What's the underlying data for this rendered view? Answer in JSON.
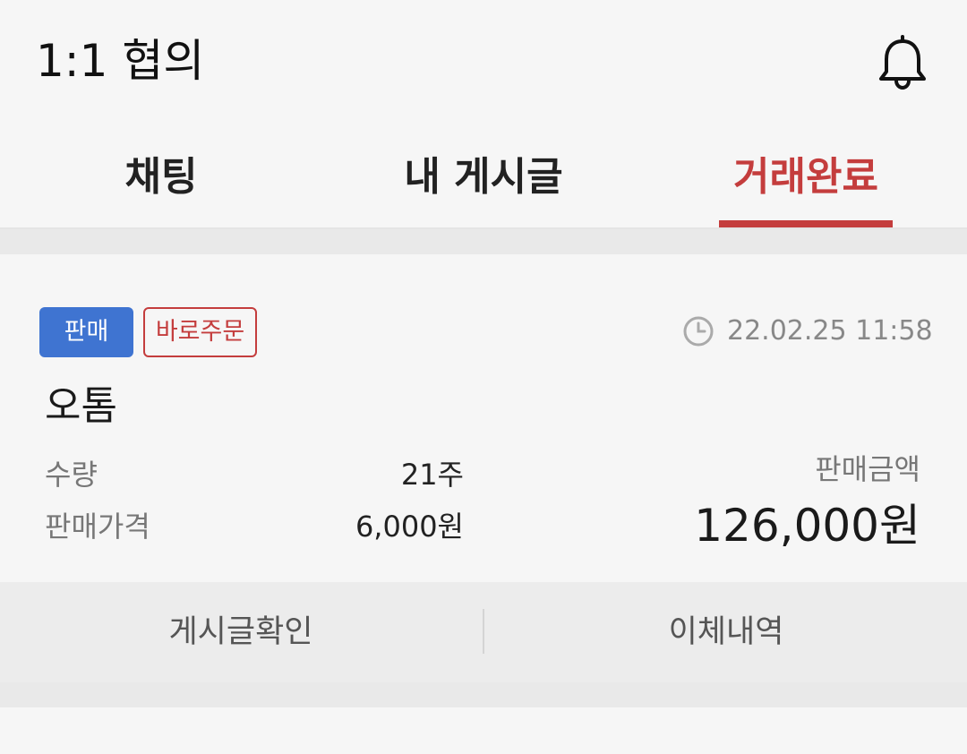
{
  "header": {
    "title": "1:1 협의",
    "notification_icon": "bell-icon"
  },
  "tabs": [
    {
      "label": "채팅",
      "active": false
    },
    {
      "label": "내 게시글",
      "active": false
    },
    {
      "label": "거래완료",
      "active": true
    }
  ],
  "colors": {
    "accent": "#c43d3d",
    "sell_badge": "#3f74d1"
  },
  "trade": {
    "badges": {
      "type": "판매",
      "method": "바로주문"
    },
    "datetime_icon": "clock-icon",
    "datetime": "22.02.25 11:58",
    "stock_name": "오톰",
    "quantity_label": "수량",
    "quantity_value": "21주",
    "price_label": "판매가격",
    "price_value": "6,000원",
    "amount_label": "판매금액",
    "amount_value": "126,000원",
    "actions": {
      "view_post": "게시글확인",
      "transfer_history": "이체내역"
    }
  }
}
